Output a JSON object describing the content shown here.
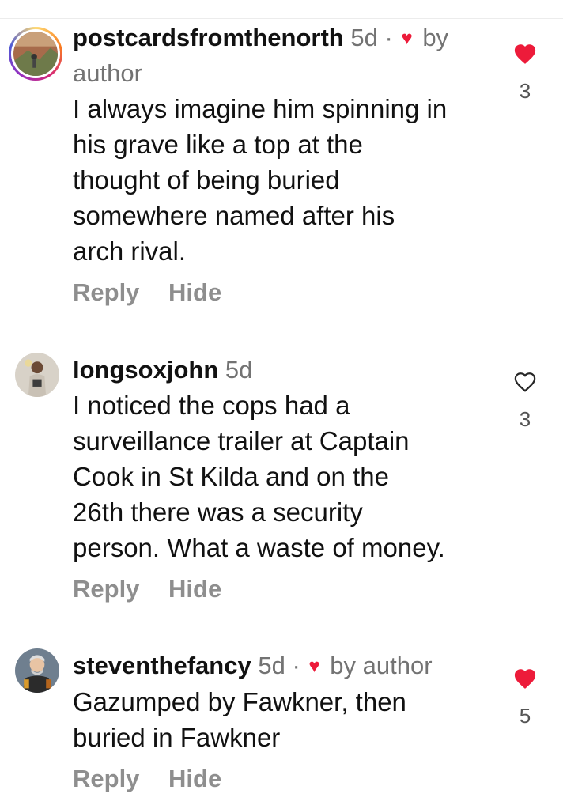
{
  "comments": [
    {
      "username": "postcardsfromthenorth",
      "time": "5d",
      "separator": "·",
      "by_author": "by author",
      "text": "I always imagine him spinning in\nhis grave like a top at the\nthought of being buried\nsomewhere named after his\narch rival.",
      "reply_label": "Reply",
      "hide_label": "Hide",
      "likes": "3",
      "liked": true
    },
    {
      "username": "longsoxjohn",
      "time": "5d",
      "text": "I noticed the cops had a\nsurveillance trailer at Captain\nCook in St Kilda and on the\n26th there was a security\nperson. What a waste of money.",
      "reply_label": "Reply",
      "hide_label": "Hide",
      "likes": "3",
      "liked": false
    },
    {
      "username": "steventhefancy",
      "time": "5d",
      "separator": "·",
      "by_author": "by author",
      "text": "Gazumped by Fawkner, then\nburied in Fawkner",
      "reply_label": "Reply",
      "hide_label": "Hide",
      "likes": "5",
      "liked": true
    }
  ],
  "icons": {
    "heart_filled": "heart-filled-icon",
    "heart_outline": "heart-outline-icon",
    "small_heart": "♥"
  },
  "colors": {
    "like_red": "#ed1b3a",
    "secondary_text": "#737373",
    "action_text": "#8e8e8e"
  }
}
